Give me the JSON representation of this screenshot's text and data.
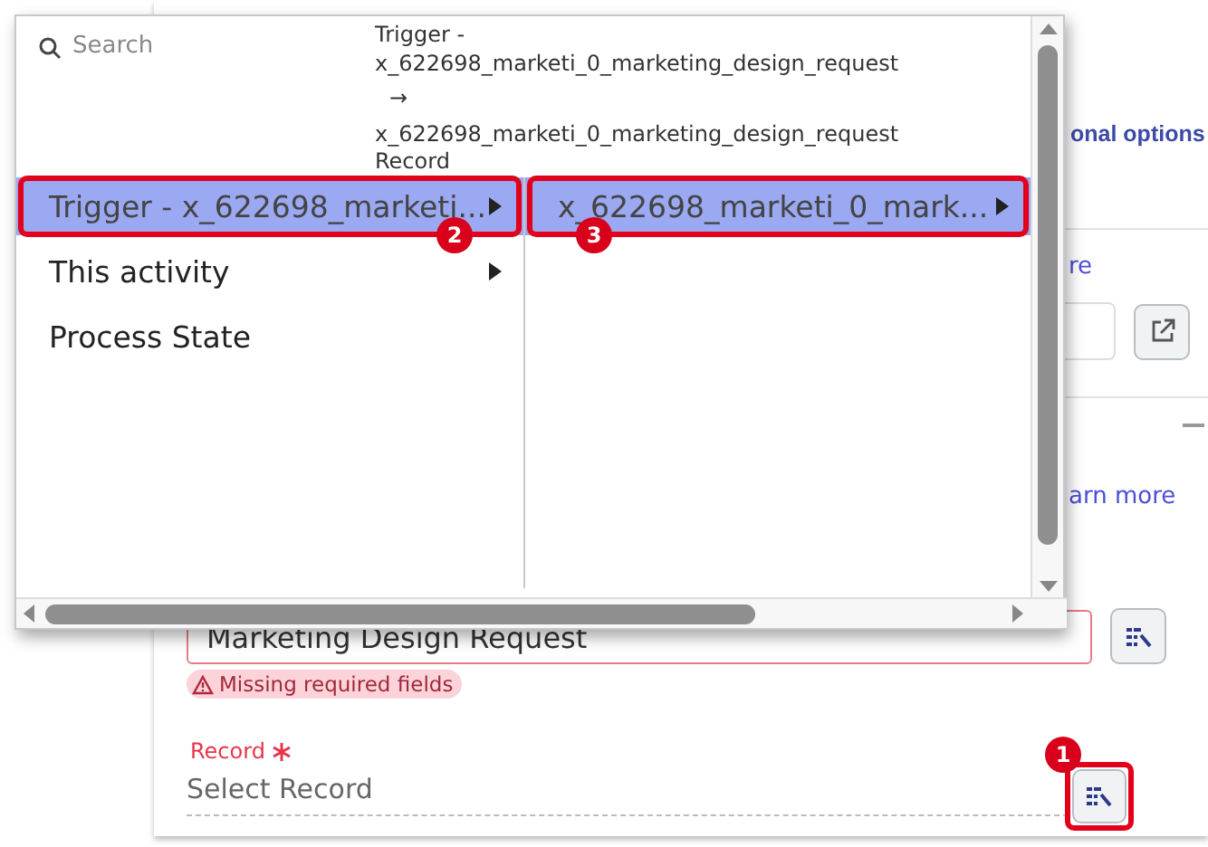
{
  "popup": {
    "search": {
      "placeholder": "Search"
    },
    "path": [
      "Trigger -",
      "x_622698_marketi_0_marketing_design_request",
      "→",
      "x_622698_marketi_0_marketing_design_request",
      "Record"
    ],
    "columns": [
      [
        {
          "label": "Trigger - x_622698_marketi...",
          "selected": true,
          "has_submenu": true,
          "callout": "2"
        },
        {
          "label": "This activity",
          "selected": false,
          "has_submenu": true
        },
        {
          "label": "Process State",
          "selected": false,
          "has_submenu": false
        }
      ],
      [
        {
          "label": "x_622698_marketi_0_mark...",
          "selected": true,
          "has_submenu": true,
          "callout": "3"
        }
      ]
    ]
  },
  "form": {
    "options_link": "onal options",
    "link_1": "re",
    "link_2": "arn more",
    "name_field": {
      "value": "Marketing Design Request",
      "error": "Missing required fields"
    },
    "record_field": {
      "label": "Record",
      "required": true,
      "placeholder": "Select Record",
      "callout": "1"
    }
  }
}
